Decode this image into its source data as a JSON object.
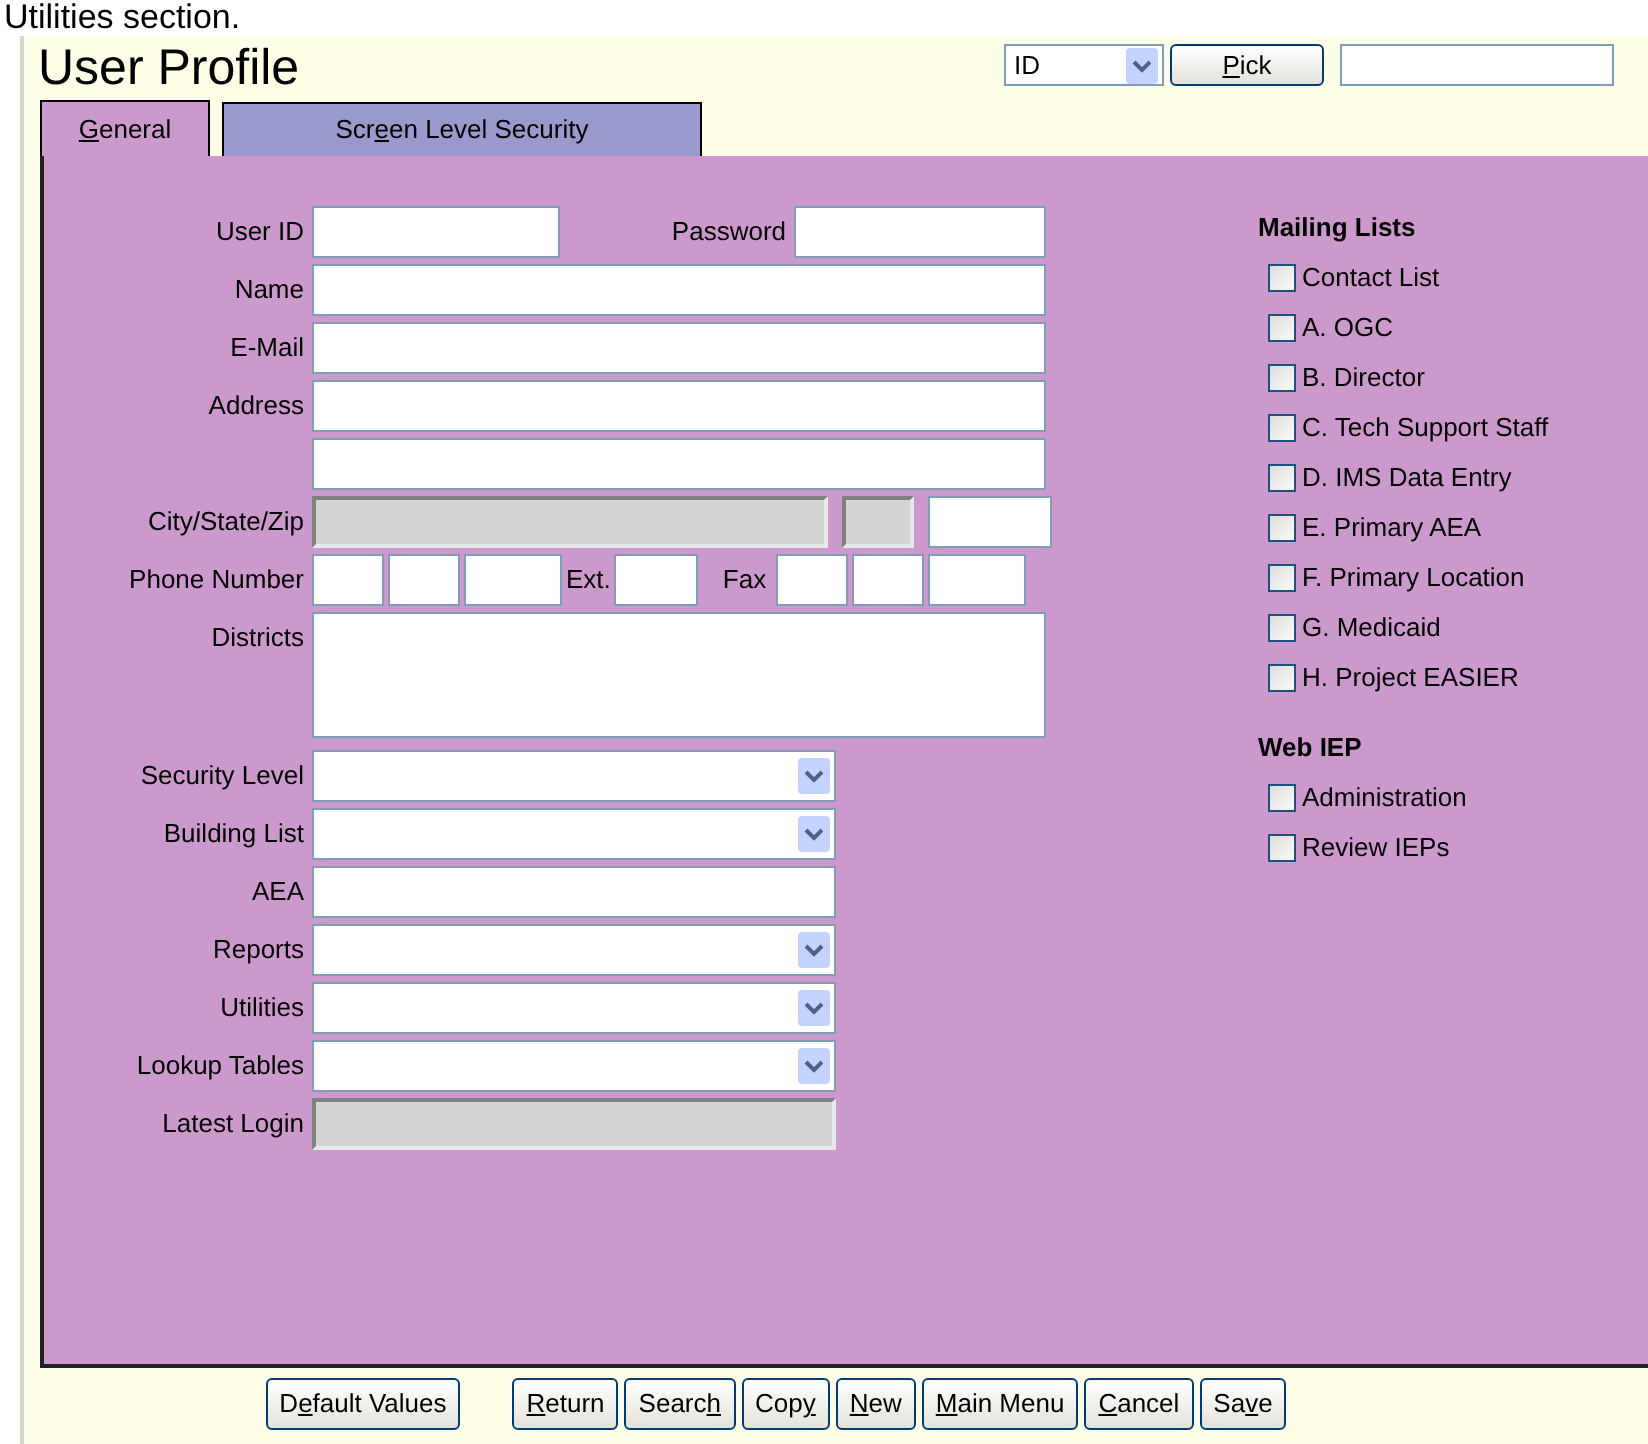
{
  "caption": "Utilities section.",
  "title": "User Profile",
  "lookup": {
    "select_value": "ID",
    "pick_button": {
      "key": "P",
      "after": "ick"
    }
  },
  "tabs": [
    {
      "label": {
        "key": "G",
        "after": "eneral"
      },
      "selected": true
    },
    {
      "label": {
        "before": "Scr",
        "key": "e",
        "after": "en Level Security"
      },
      "selected": false
    }
  ],
  "form": {
    "user_id": {
      "label": "User ID"
    },
    "password": {
      "label": "Password"
    },
    "name": {
      "label": "Name"
    },
    "email": {
      "label": "E-Mail"
    },
    "address": {
      "label": "Address"
    },
    "city_state_zip": {
      "label": "City/State/Zip",
      "city": {
        "disabled": true
      },
      "state": {
        "disabled": true
      },
      "zip": {
        "disabled": false
      }
    },
    "phone": {
      "label": "Phone Number",
      "ext_label": "Ext.",
      "fax_label": "Fax"
    },
    "districts": {
      "label": "Districts"
    },
    "lower_fields": [
      {
        "label": "Security Level",
        "kind": "select",
        "disabled": false
      },
      {
        "label": "Building List",
        "kind": "select",
        "disabled": false
      },
      {
        "label": "AEA",
        "kind": "text",
        "disabled": false
      },
      {
        "label": "Reports",
        "kind": "select",
        "disabled": false
      },
      {
        "label": "Utilities",
        "kind": "select",
        "disabled": false
      },
      {
        "label": "Lookup Tables",
        "kind": "select",
        "disabled": false
      },
      {
        "label": "Latest Login",
        "kind": "text",
        "disabled": true
      }
    ]
  },
  "checkbox_groups": [
    {
      "heading": "Mailing Lists",
      "items": [
        {
          "label": "Contact List",
          "checked": false
        },
        {
          "label": "A. OGC",
          "checked": false
        },
        {
          "label": "B. Director",
          "checked": false
        },
        {
          "label": "C. Tech Support Staff",
          "checked": false
        },
        {
          "label": "D. IMS Data Entry",
          "checked": false
        },
        {
          "label": "E. Primary AEA",
          "checked": false
        },
        {
          "label": "F. Primary Location",
          "checked": false
        },
        {
          "label": "G. Medicaid",
          "checked": false
        },
        {
          "label": "H. Project EASIER",
          "checked": false
        }
      ]
    },
    {
      "heading": "Web IEP",
      "items": [
        {
          "label": "Administration",
          "checked": false
        },
        {
          "label": "Review IEPs",
          "checked": false
        }
      ]
    }
  ],
  "button_groups": [
    [
      {
        "label": {
          "before": "D",
          "key": "e",
          "after": "fault Values"
        }
      }
    ],
    [
      {
        "label": {
          "key": "R",
          "after": "eturn"
        }
      },
      {
        "label": {
          "before": "Searc",
          "key": "h"
        }
      },
      {
        "label": {
          "before": "Cop",
          "key": "y"
        }
      },
      {
        "label": {
          "key": "N",
          "after": "ew"
        }
      },
      {
        "label": {
          "key": "M",
          "after": "ain Menu"
        }
      },
      {
        "label": {
          "key": "C",
          "after": "ancel"
        }
      },
      {
        "label": {
          "before": "Sa",
          "key": "v",
          "after": "e"
        }
      }
    ]
  ]
}
